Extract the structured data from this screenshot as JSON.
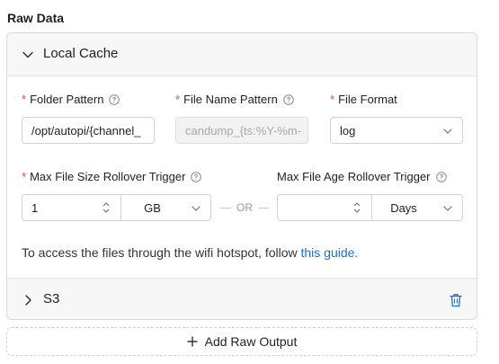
{
  "section_title": "Raw Data",
  "local_cache": {
    "title": "Local Cache",
    "folder_pattern": {
      "label": "Folder Pattern",
      "value": "/opt/autopi/{channel_"
    },
    "file_name_pattern": {
      "label": "File Name Pattern",
      "value": "candump_{ts:%Y-%m-"
    },
    "file_format": {
      "label": "File Format",
      "value": "log"
    },
    "max_size": {
      "label": "Max File Size Rollover Trigger",
      "value": "1",
      "unit": "GB"
    },
    "or_text": "OR",
    "max_age": {
      "label": "Max File Age Rollover Trigger",
      "value": "",
      "unit": "Days"
    },
    "note_text": "To access the files through the wifi hotspot, follow ",
    "note_link": "this guide."
  },
  "s3": {
    "title": "S3"
  },
  "add_button": "Add Raw Output",
  "colors": {
    "accent": "#1a6fd6",
    "required": "#e5484d"
  }
}
